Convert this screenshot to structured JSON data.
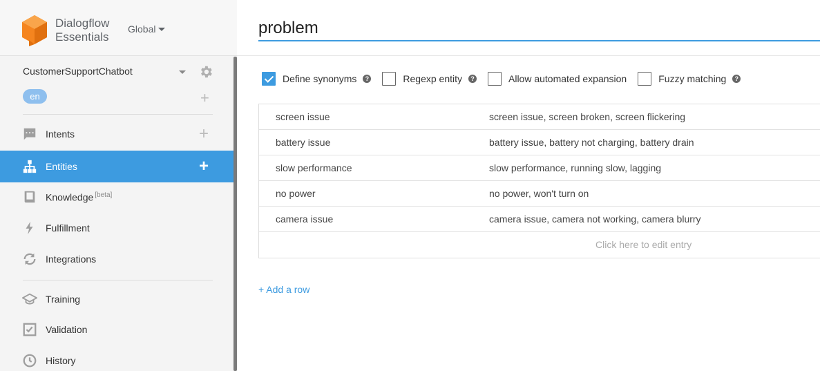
{
  "brand": {
    "line1": "Dialogflow",
    "line2": "Essentials",
    "region": "Global",
    "logo_color": "#f5851f"
  },
  "agent": {
    "name": "CustomerSupportChatbot",
    "language": "en"
  },
  "nav": {
    "items": [
      {
        "label": "Intents",
        "icon": "chat-icon",
        "has_add": true,
        "active": false
      },
      {
        "label": "Entities",
        "icon": "hierarchy-icon",
        "has_add": true,
        "active": true
      },
      {
        "label": "Knowledge",
        "badge": "[beta]",
        "icon": "book-icon",
        "has_add": false,
        "active": false
      },
      {
        "label": "Fulfillment",
        "icon": "bolt-icon",
        "has_add": false,
        "active": false
      },
      {
        "label": "Integrations",
        "icon": "sync-icon",
        "has_add": false,
        "active": false
      },
      {
        "label": "Training",
        "icon": "graduation-cap-icon",
        "has_add": false,
        "active": false
      },
      {
        "label": "Validation",
        "icon": "check-box-icon",
        "has_add": false,
        "active": false
      },
      {
        "label": "History",
        "icon": "clock-icon",
        "has_add": false,
        "active": false
      }
    ]
  },
  "entity": {
    "title": "problem",
    "options": [
      {
        "label": "Define synonyms",
        "checked": true,
        "help": true
      },
      {
        "label": "Regexp entity",
        "checked": false,
        "help": true
      },
      {
        "label": "Allow automated expansion",
        "checked": false,
        "help": false
      },
      {
        "label": "Fuzzy matching",
        "checked": false,
        "help": true
      }
    ],
    "entries": [
      {
        "value": "screen issue",
        "synonyms": "screen issue, screen broken, screen flickering"
      },
      {
        "value": "battery issue",
        "synonyms": "battery issue, battery not charging, battery drain"
      },
      {
        "value": "slow performance",
        "synonyms": "slow performance, running slow, lagging"
      },
      {
        "value": "no power",
        "synonyms": "no power, won't turn on"
      },
      {
        "value": "camera issue",
        "synonyms": "camera issue, camera not working, camera blurry"
      }
    ],
    "edit_hint": "Click here to edit entry",
    "add_row": "+ Add a row"
  },
  "colors": {
    "accent": "#3d9be0",
    "sidebar_bg": "#f4f4f4"
  }
}
